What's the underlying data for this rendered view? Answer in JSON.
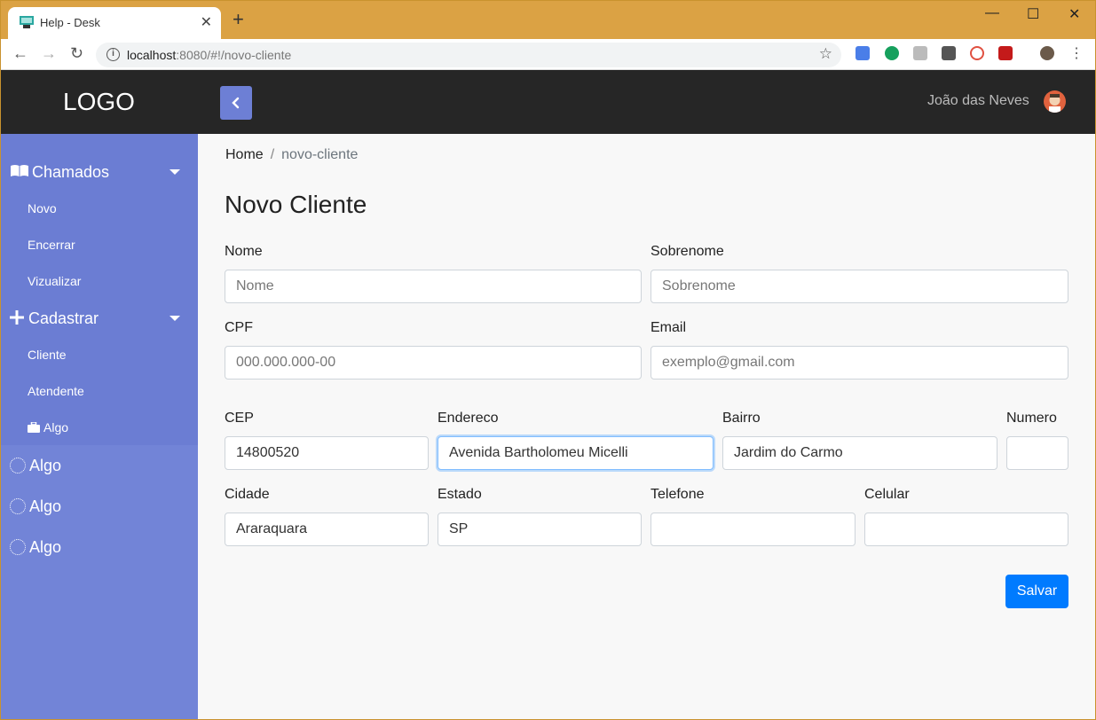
{
  "browser": {
    "tab_title": "Help - Desk",
    "url_host": "localhost",
    "url_rest": ":8080/#!/novo-cliente",
    "window_controls": {
      "minimize": "—",
      "maximize": "☐",
      "close": "✕"
    }
  },
  "header": {
    "logo": "LOGO",
    "user_name": "João das Neves"
  },
  "sidebar": {
    "groups": [
      {
        "label": "Chamados",
        "icon": "book-icon",
        "items": [
          {
            "label": "Novo"
          },
          {
            "label": "Encerrar"
          },
          {
            "label": "Vizualizar"
          }
        ]
      },
      {
        "label": "Cadastrar",
        "icon": "plus-icon",
        "items": [
          {
            "label": "Cliente"
          },
          {
            "label": "Atendente"
          },
          {
            "label": "Algo",
            "icon": "briefcase-icon"
          }
        ]
      }
    ],
    "plain_items": [
      {
        "label": "Algo"
      },
      {
        "label": "Algo"
      },
      {
        "label": "Algo"
      }
    ]
  },
  "breadcrumb": {
    "home": "Home",
    "separator": "/",
    "current": "novo-cliente"
  },
  "page_title": "Novo Cliente",
  "form": {
    "nome": {
      "label": "Nome",
      "placeholder": "Nome",
      "value": ""
    },
    "sobrenome": {
      "label": "Sobrenome",
      "placeholder": "Sobrenome",
      "value": ""
    },
    "cpf": {
      "label": "CPF",
      "placeholder": "000.000.000-00",
      "value": ""
    },
    "email": {
      "label": "Email",
      "placeholder": "exemplo@gmail.com",
      "value": ""
    },
    "cep": {
      "label": "CEP",
      "value": "14800520"
    },
    "endereco": {
      "label": "Endereco",
      "value": "Avenida Bartholomeu Micelli"
    },
    "bairro": {
      "label": "Bairro",
      "value": "Jardim do Carmo"
    },
    "numero": {
      "label": "Numero",
      "value": ""
    },
    "cidade": {
      "label": "Cidade",
      "value": "Araraquara"
    },
    "estado": {
      "label": "Estado",
      "value": "SP"
    },
    "telefone": {
      "label": "Telefone",
      "value": ""
    },
    "celular": {
      "label": "Celular",
      "value": ""
    },
    "save_label": "Salvar"
  },
  "colors": {
    "sidebar": "#7284d7",
    "header": "#262626",
    "primary": "#007bff",
    "chrome": "#dba244"
  }
}
